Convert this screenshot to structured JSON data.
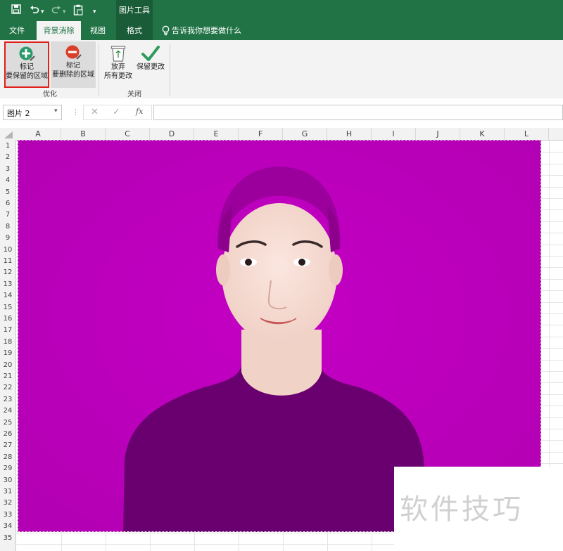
{
  "quick_access": {
    "save_icon": "save-icon",
    "undo_icon": "undo-icon",
    "redo_icon": "redo-icon",
    "clipboard_icon": "clipboard-icon",
    "customize_icon": "customize-qat-icon"
  },
  "context_group": {
    "label": "图片工具"
  },
  "tabs": {
    "file": "文件",
    "background_removal": "背景消除",
    "view": "视图",
    "format": "格式",
    "tell_me": "告诉我你想要做什么"
  },
  "ribbon": {
    "mark_keep_line1": "标记",
    "mark_keep_line2": "要保留的区域",
    "mark_remove_line1": "标记",
    "mark_remove_line2": "要删除的区域",
    "refine_group": "优化",
    "discard_line1": "放弃",
    "discard_line2": "所有更改",
    "keep_changes": "保留更改",
    "close_group": "关闭"
  },
  "formula_bar": {
    "name_box": "图片 2",
    "fx": "fx",
    "formula": ""
  },
  "columns": [
    "A",
    "B",
    "C",
    "D",
    "E",
    "F",
    "G",
    "H",
    "I",
    "J",
    "K",
    "L"
  ],
  "rows": [
    "1",
    "2",
    "3",
    "4",
    "5",
    "6",
    "7",
    "8",
    "9",
    "10",
    "11",
    "12",
    "13",
    "14",
    "15",
    "16",
    "17",
    "18",
    "19",
    "20",
    "21",
    "22",
    "23",
    "24",
    "25",
    "26",
    "27",
    "28",
    "29",
    "30",
    "31",
    "32",
    "33",
    "34",
    "35"
  ],
  "watermark": "软件技巧",
  "colors": {
    "excel_green": "#217346",
    "background_removal_magenta": "#bb00bb",
    "highlight_red": "#e0201a"
  }
}
